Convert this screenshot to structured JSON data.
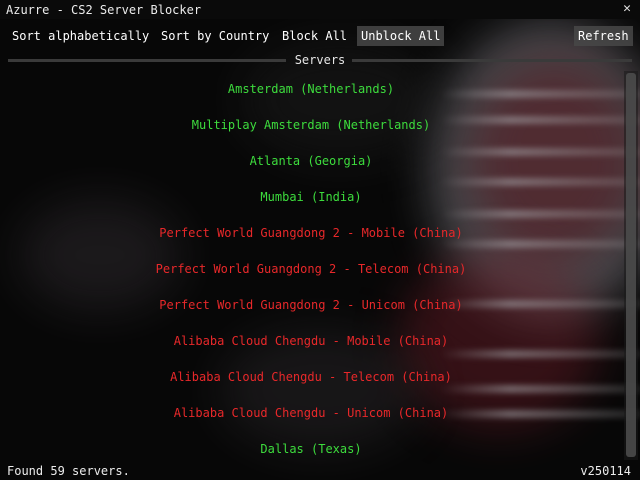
{
  "window": {
    "title": "Azurre - CS2 Server Blocker",
    "close_icon": "close-icon"
  },
  "toolbar": {
    "sort_alpha_label": "Sort alphabetically",
    "sort_country_label": "Sort by Country",
    "block_all_label": "Block All",
    "unblock_all_label": "Unblock All",
    "refresh_label": "Refresh"
  },
  "servers_heading": "Servers",
  "colors": {
    "allowed": "#3ddc3d",
    "blocked": "#e8282a"
  },
  "servers": [
    {
      "name": "Amsterdam (Netherlands)",
      "status": "allowed"
    },
    {
      "name": "Multiplay Amsterdam (Netherlands)",
      "status": "allowed"
    },
    {
      "name": "Atlanta (Georgia)",
      "status": "allowed"
    },
    {
      "name": "Mumbai (India)",
      "status": "allowed"
    },
    {
      "name": "Perfect World Guangdong 2 - Mobile (China)",
      "status": "blocked"
    },
    {
      "name": "Perfect World Guangdong 2 - Telecom (China)",
      "status": "blocked"
    },
    {
      "name": "Perfect World Guangdong 2 - Unicom (China)",
      "status": "blocked"
    },
    {
      "name": "Alibaba Cloud Chengdu - Mobile (China)",
      "status": "blocked"
    },
    {
      "name": "Alibaba Cloud Chengdu - Telecom (China)",
      "status": "blocked"
    },
    {
      "name": "Alibaba Cloud Chengdu - Unicom (China)",
      "status": "blocked"
    },
    {
      "name": "Dallas (Texas)",
      "status": "allowed"
    }
  ],
  "status": {
    "found_text": "Found 59 servers.",
    "version": "v250114"
  }
}
